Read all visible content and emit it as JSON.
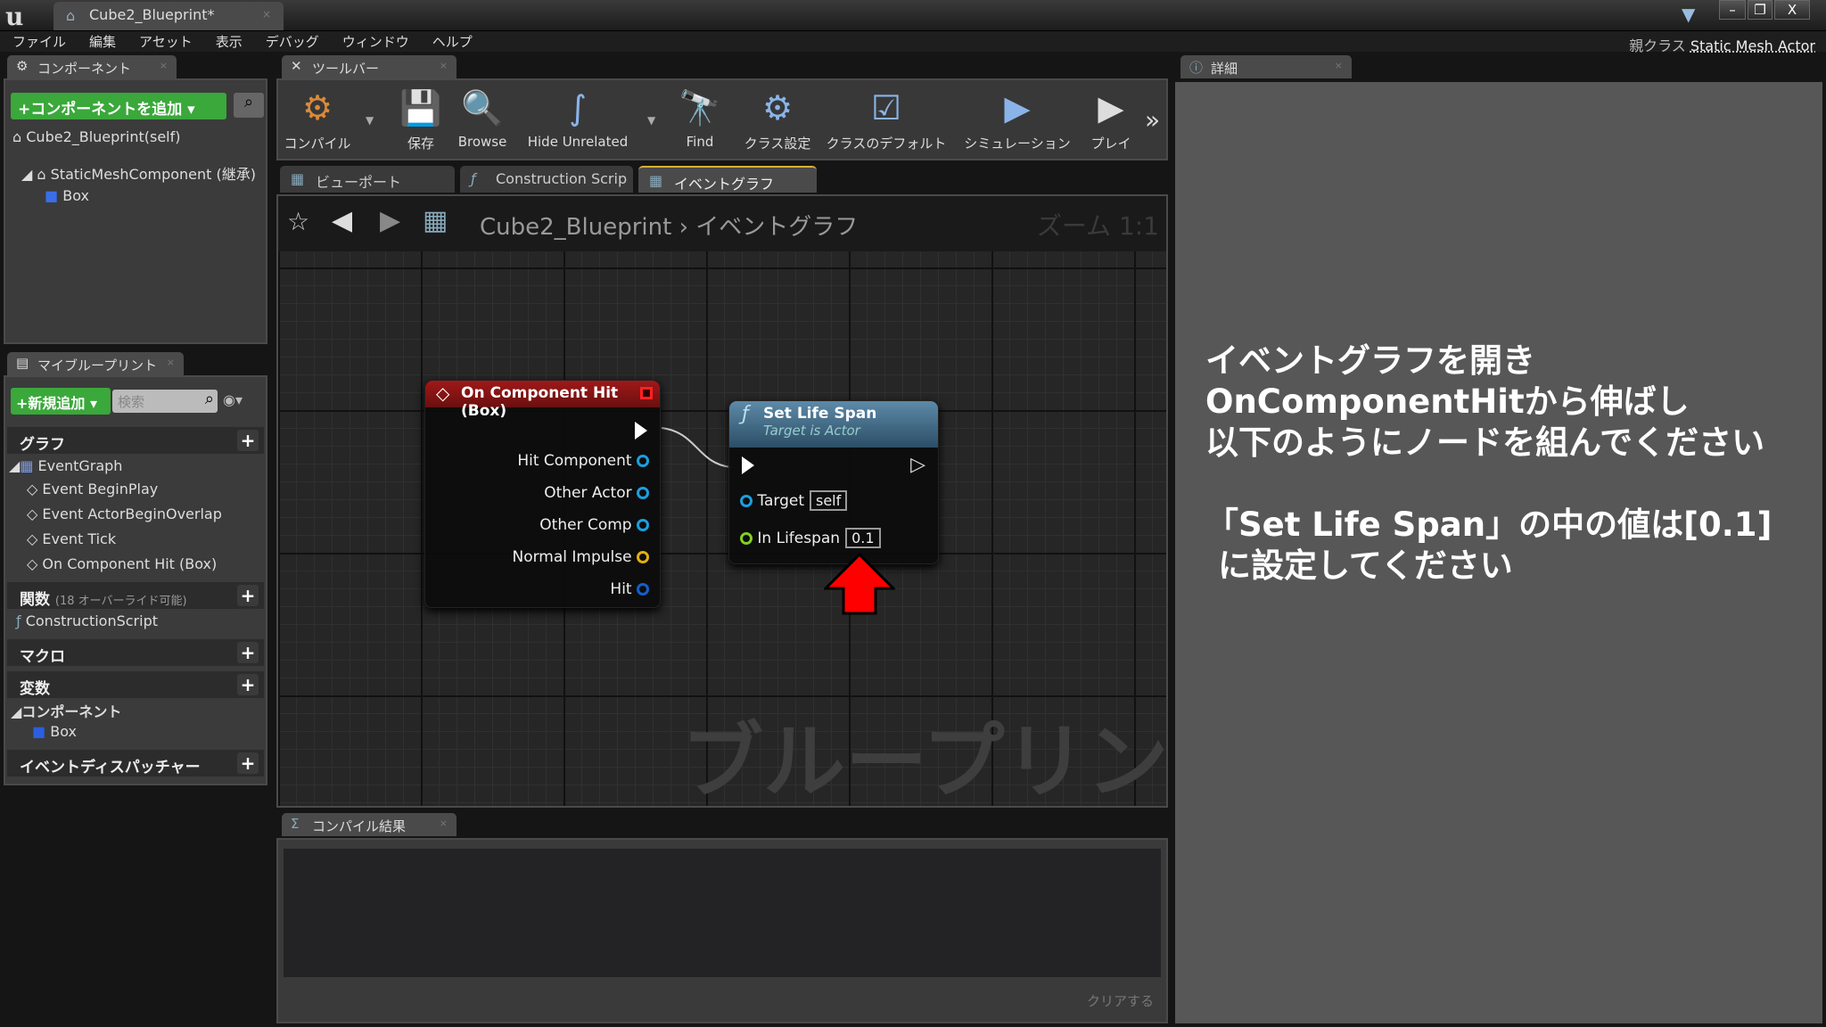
{
  "window": {
    "doc_tab": "Cube2_Blueprint*",
    "minimize": "–",
    "restore": "❐",
    "close": "X"
  },
  "menu": [
    "ファイル",
    "編集",
    "アセット",
    "表示",
    "デバッグ",
    "ウィンドウ",
    "ヘルプ"
  ],
  "parent_class": {
    "label": "親クラス",
    "value": "Static Mesh Actor"
  },
  "components": {
    "tab": "コンポーネント",
    "add_button": "+コンポーネントを追加",
    "self": "Cube2_Blueprint(self)",
    "static_mesh": "StaticMeshComponent (継承)",
    "box": "Box"
  },
  "toolbar": {
    "tab": "ツールバー",
    "buttons": [
      {
        "label": "コンパイル",
        "icon": "⚙"
      },
      {
        "label": "保存",
        "icon": "💾"
      },
      {
        "label": "Browse",
        "icon": "🔍"
      },
      {
        "label": "Hide Unrelated",
        "icon": "∫"
      },
      {
        "label": "Find",
        "icon": "🔭"
      },
      {
        "label": "クラス設定",
        "icon": "⚙"
      },
      {
        "label": "クラスのデフォルト",
        "icon": "☑"
      },
      {
        "label": "シミュレーション",
        "icon": "▶"
      },
      {
        "label": "プレイ",
        "icon": "▶"
      }
    ]
  },
  "graph_tabs": [
    "ビューポート",
    "Construction Scrip",
    "イベントグラフ"
  ],
  "breadcrumb": {
    "root": "Cube2_Blueprint",
    "separator": "›",
    "current": "イベントグラフ",
    "zoom": "ズーム 1:1"
  },
  "watermark": "ブループリント",
  "node_hit": {
    "title": "On Component Hit (Box)",
    "pins": [
      "Hit Component",
      "Other Actor",
      "Other Comp",
      "Normal Impulse",
      "Hit"
    ]
  },
  "node_lifespan": {
    "title": "Set Life Span",
    "subtitle": "Target is Actor",
    "target_label": "Target",
    "target_value": "self",
    "lifespan_label": "In Lifespan",
    "lifespan_value": "0.1"
  },
  "my_blueprint": {
    "tab": "マイブループリント",
    "add_button": "+新規追加",
    "search_placeholder": "検索",
    "graph_header": "グラフ",
    "event_graph": "EventGraph",
    "events": [
      "Event BeginPlay",
      "Event ActorBeginOverlap",
      "Event Tick",
      "On Component Hit (Box)"
    ],
    "functions_header": "関数",
    "functions_note": "(18 オーバーライド可能)",
    "construction_script": "ConstructionScript",
    "macros_header": "マクロ",
    "variables_header": "変数",
    "components_header": "コンポーネント",
    "box": "Box",
    "dispatchers_header": "イベントディスパッチャー"
  },
  "compile_results": {
    "tab": "コンパイル結果",
    "clear": "クリアする"
  },
  "details": {
    "tab": "詳細"
  },
  "instructions": {
    "line1": "イベントグラフを開き",
    "line2": "OnComponentHitから伸ばし",
    "line3": "以下のようにノードを組んでください",
    "line4": "「Set Life Span」の中の値は[0.1]",
    "line5": "に設定してください"
  }
}
